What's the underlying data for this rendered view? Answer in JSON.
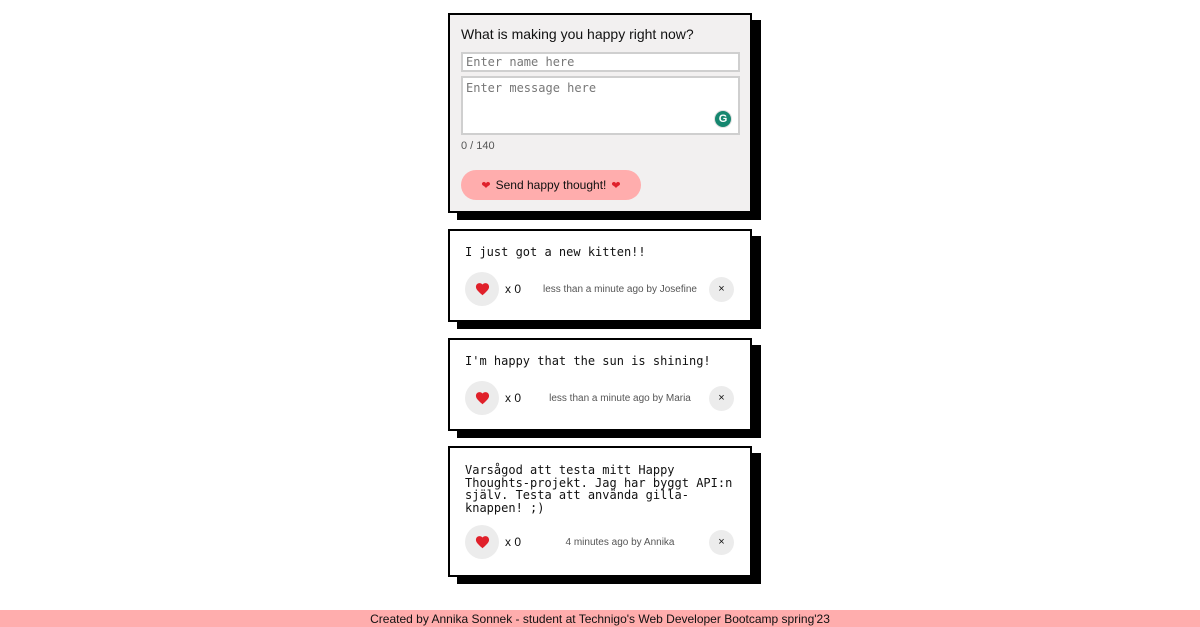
{
  "form": {
    "title": "What is making you happy right now?",
    "name_placeholder": "Enter name here",
    "name_value": "",
    "message_placeholder": "Enter message here",
    "message_value": "",
    "char_count": "0 / 140",
    "send_label": "Send happy thought!",
    "grammarly_letter": "G"
  },
  "thoughts": [
    {
      "message": "I just got a new kitten!!",
      "likes": "x 0",
      "meta": "less than a minute ago by Josefine",
      "delete_label": "×"
    },
    {
      "message": "I'm happy that the sun is shining!",
      "likes": "x 0",
      "meta": "less than a minute ago by Maria",
      "delete_label": "×"
    },
    {
      "message": "Varsågod att testa mitt Happy Thoughts-projekt. Jag har byggt API:n själv. Testa att använda gilla-knappen! ;)",
      "likes": "x 0",
      "meta": "4 minutes ago by Annika",
      "delete_label": "×"
    }
  ],
  "footer": {
    "text": "Created by Annika Sonnek - student at Technigo's Web Developer Bootcamp spring'23"
  },
  "colors": {
    "accent_pink": "#ffadad",
    "heart_red": "#e0202a",
    "form_bg": "#f2f0f0",
    "grammarly_green": "#15866f"
  },
  "icons": {
    "heart": "heart-icon",
    "close": "close-icon",
    "grammarly": "grammarly-icon"
  }
}
